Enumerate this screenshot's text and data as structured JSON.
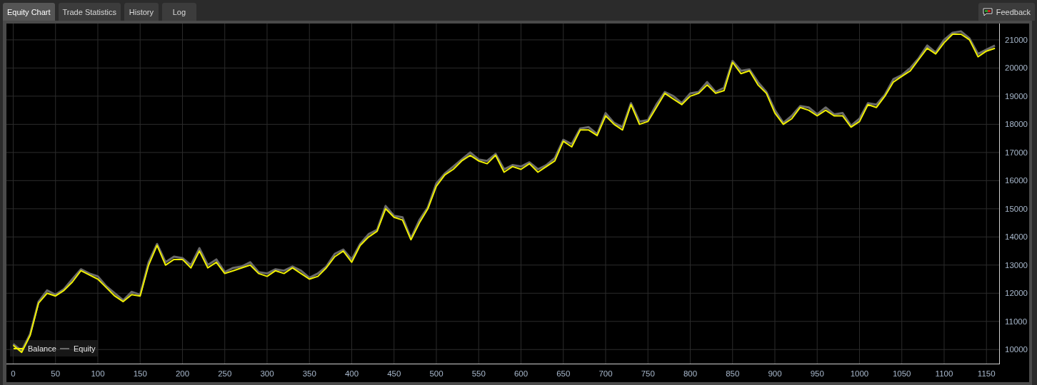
{
  "tabs": [
    {
      "label": "Equity Chart",
      "selected": true
    },
    {
      "label": "Trade Statistics",
      "selected": false
    },
    {
      "label": "History",
      "selected": false
    },
    {
      "label": "Log",
      "selected": false
    }
  ],
  "feedback_button": {
    "label": "Feedback"
  },
  "chart_data": {
    "type": "line",
    "grid": true,
    "legend": true,
    "xlim": [
      -8,
      1165
    ],
    "ylim": [
      9500,
      21580
    ],
    "xticks": [
      0,
      50,
      100,
      150,
      200,
      250,
      300,
      350,
      400,
      450,
      500,
      550,
      600,
      650,
      700,
      750,
      800,
      850,
      900,
      950,
      1000,
      1050,
      1100,
      1150
    ],
    "yticks": [
      10000,
      11000,
      12000,
      13000,
      14000,
      15000,
      16000,
      17000,
      18000,
      19000,
      20000,
      21000
    ],
    "x": [
      0,
      10,
      20,
      30,
      40,
      50,
      60,
      70,
      80,
      90,
      100,
      110,
      120,
      130,
      140,
      150,
      160,
      170,
      180,
      190,
      200,
      210,
      220,
      230,
      240,
      250,
      260,
      270,
      280,
      290,
      300,
      310,
      320,
      330,
      340,
      350,
      360,
      370,
      380,
      390,
      400,
      410,
      420,
      430,
      440,
      450,
      460,
      470,
      480,
      490,
      500,
      510,
      520,
      530,
      540,
      550,
      560,
      570,
      580,
      590,
      600,
      610,
      620,
      630,
      640,
      650,
      660,
      670,
      680,
      690,
      700,
      710,
      720,
      730,
      740,
      750,
      760,
      770,
      780,
      790,
      800,
      810,
      820,
      830,
      840,
      850,
      860,
      870,
      880,
      890,
      900,
      910,
      920,
      930,
      940,
      950,
      960,
      970,
      980,
      990,
      1000,
      1010,
      1020,
      1030,
      1040,
      1050,
      1060,
      1070,
      1080,
      1090,
      1100,
      1110,
      1120,
      1130,
      1140,
      1150,
      1160
    ],
    "series": [
      {
        "name": "Balance",
        "color": "#f0f000",
        "values": [
          10150,
          9900,
          10500,
          11650,
          12000,
          11900,
          12100,
          12400,
          12800,
          12650,
          12500,
          12200,
          11900,
          11700,
          11950,
          11900,
          13000,
          13700,
          13000,
          13200,
          13200,
          12900,
          13500,
          12900,
          13100,
          12700,
          12800,
          12900,
          13000,
          12700,
          12600,
          12800,
          12700,
          12900,
          12700,
          12500,
          12600,
          12900,
          13300,
          13500,
          13100,
          13700,
          14000,
          14200,
          15000,
          14700,
          14600,
          13900,
          14500,
          15000,
          15800,
          16200,
          16400,
          16700,
          16900,
          16700,
          16600,
          16900,
          16300,
          16500,
          16400,
          16600,
          16300,
          16500,
          16700,
          17400,
          17200,
          17800,
          17800,
          17600,
          18300,
          18000,
          17800,
          18700,
          18000,
          18100,
          18600,
          19100,
          18900,
          18700,
          19000,
          19100,
          19400,
          19100,
          19200,
          20200,
          19800,
          19900,
          19400,
          19100,
          18400,
          18000,
          18200,
          18600,
          18500,
          18300,
          18500,
          18300,
          18300,
          17900,
          18100,
          18700,
          18600,
          19000,
          19500,
          19700,
          19900,
          20300,
          20700,
          20500,
          20900,
          21200,
          21200,
          21000,
          20400,
          20600,
          20700
        ]
      },
      {
        "name": "Equity",
        "color": "#6a6a6a",
        "values": [
          10200,
          9950,
          10550,
          11700,
          12100,
          11950,
          12150,
          12500,
          12850,
          12700,
          12600,
          12250,
          12000,
          11750,
          12050,
          11950,
          13100,
          13750,
          13100,
          13300,
          13250,
          13000,
          13600,
          13000,
          13200,
          12750,
          12900,
          12950,
          13100,
          12750,
          12700,
          12850,
          12800,
          12950,
          12800,
          12550,
          12700,
          12950,
          13400,
          13550,
          13200,
          13750,
          14100,
          14250,
          15100,
          14750,
          14700,
          13950,
          14600,
          15050,
          15900,
          16250,
          16500,
          16750,
          17000,
          16750,
          16700,
          16950,
          16400,
          16550,
          16500,
          16650,
          16400,
          16550,
          16800,
          17450,
          17300,
          17850,
          17900,
          17650,
          18400,
          18050,
          17900,
          18750,
          18100,
          18150,
          18700,
          19150,
          19000,
          18750,
          19100,
          19150,
          19500,
          19150,
          19300,
          20250,
          19900,
          19950,
          19500,
          19150,
          18500,
          18050,
          18300,
          18650,
          18600,
          18350,
          18600,
          18350,
          18400,
          17950,
          18200,
          18750,
          18700,
          19050,
          19600,
          19750,
          20000,
          20350,
          20800,
          20550,
          21000,
          21250,
          21300,
          21050,
          20500,
          20650,
          20800
        ]
      }
    ]
  }
}
